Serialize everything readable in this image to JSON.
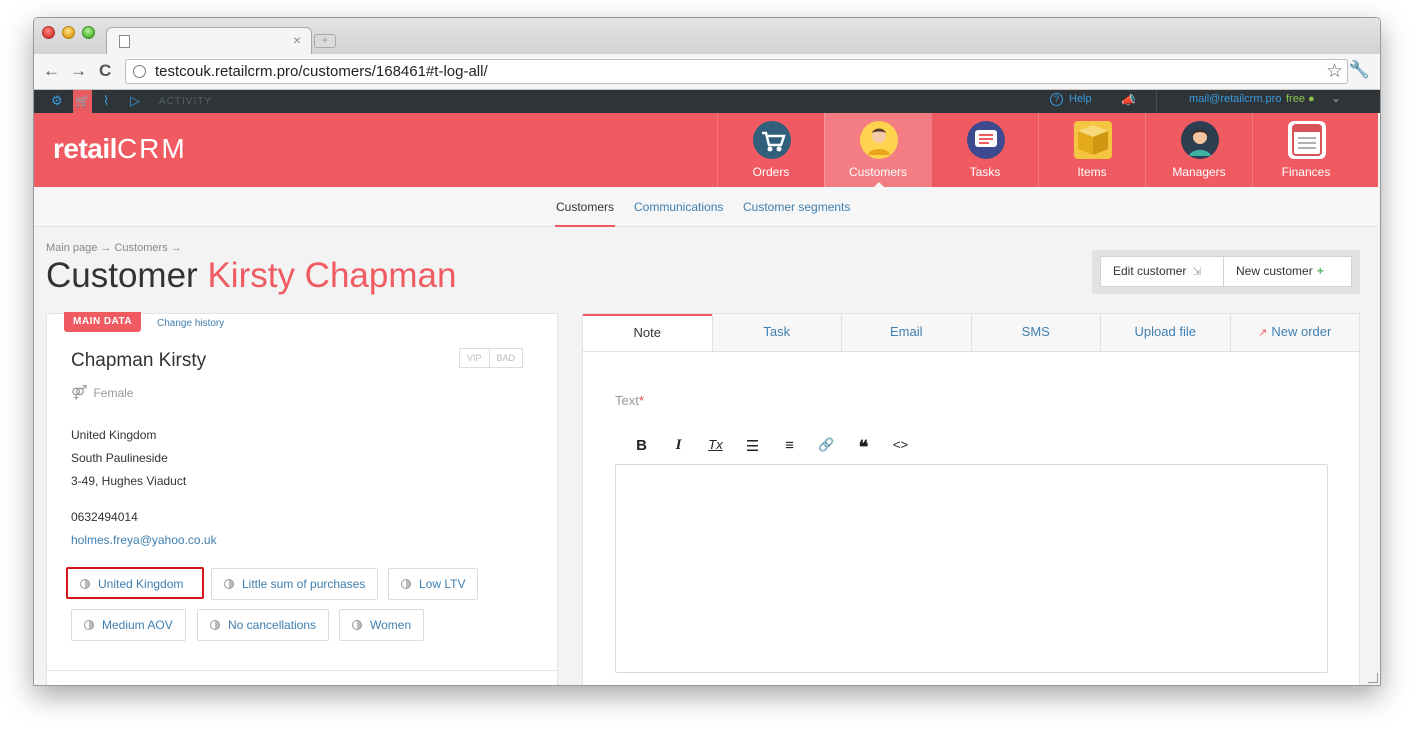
{
  "browser": {
    "tab_close": "×",
    "new_tab": "+",
    "url": "testcouk.retailcrm.pro/customers/168461#t-log-all/",
    "back": "←",
    "forward": "→",
    "reload": "C",
    "star": "☆",
    "wrench": "🔧"
  },
  "topbar": {
    "settings_icon": "⚙",
    "cart_icon": "🛒",
    "chart_icon": "⌇",
    "play_icon": "▷",
    "activity": "ACTIVITY",
    "help_icon": "?",
    "help": "Help",
    "megaphone": "📣",
    "email": "mail@retailcrm.pro",
    "plan": "free ●",
    "chevron": "⌄"
  },
  "header": {
    "logo_retail": "retail",
    "logo_crm": "CRM",
    "nav": [
      {
        "label": "Orders",
        "active": false
      },
      {
        "label": "Customers",
        "active": true
      },
      {
        "label": "Tasks",
        "active": false
      },
      {
        "label": "Items",
        "active": false
      },
      {
        "label": "Managers",
        "active": false
      },
      {
        "label": "Finances",
        "active": false
      }
    ]
  },
  "subnav": {
    "items": [
      "Customers",
      "Communications",
      "Customer segments"
    ]
  },
  "page": {
    "breadcrumb": "Main page → Customers →",
    "title_prefix": "Customer",
    "title_name": "Kirsty Chapman",
    "edit_button": "Edit customer",
    "edit_icon": "⇲",
    "new_button": "New customer",
    "new_icon": "+"
  },
  "customer": {
    "tab_main": "MAIN DATA",
    "tab_history": "Change history",
    "name": "Chapman Kirsty",
    "vip": "VIP",
    "bad": "BAD",
    "gender_icon": "⚤",
    "gender": "Female",
    "address": [
      "United Kingdom",
      "South Paulineside",
      "3-49, Hughes Viaduct"
    ],
    "phone": "0632494014",
    "email": "holmes.freya@yahoo.co.uk",
    "segments": [
      "United Kingdom",
      "Little sum of purchases",
      "Low LTV",
      "Medium AOV",
      "No cancellations",
      "Women"
    ]
  },
  "note_panel": {
    "tabs": [
      "Note",
      "Task",
      "Email",
      "SMS",
      "Upload file",
      "New order"
    ],
    "new_order_icon": "↗",
    "text_label": "Text",
    "required": "*",
    "toolbar": {
      "bold": "B",
      "italic": "I",
      "clear": "Tx",
      "bullets": "☰",
      "numbered": "≡",
      "link": "🔗",
      "quote": "❝",
      "code": "<>"
    }
  },
  "colors": {
    "brand": "#f05b62",
    "link": "#3f7fb0",
    "topbar": "#2e3438",
    "highlight_border": "#d4161c"
  }
}
